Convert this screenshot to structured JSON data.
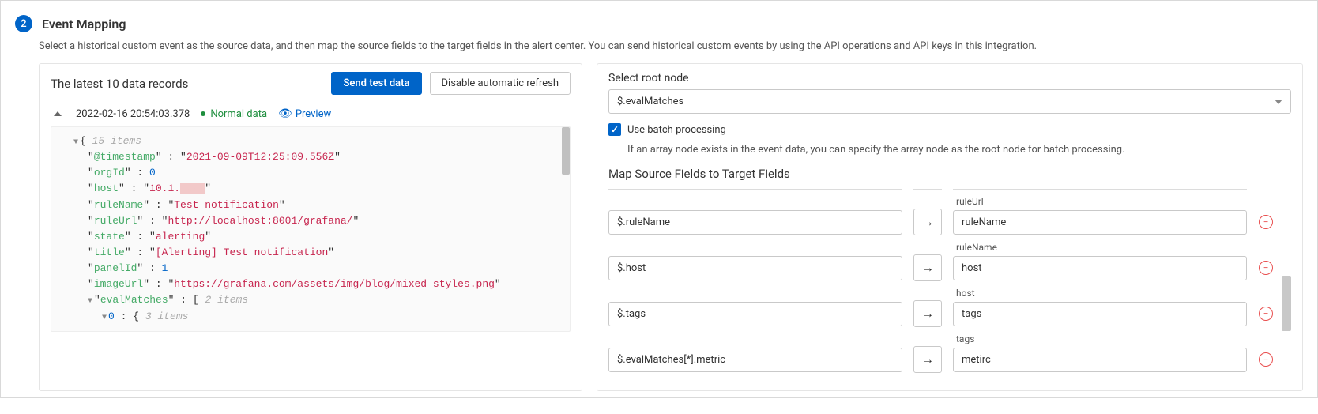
{
  "step": {
    "number": "2",
    "title": "Event Mapping"
  },
  "description": "Select a historical custom event as the source data, and then map the source fields to the target fields in the alert center. You can send historical custom events by using the API operations and API keys in this integration.",
  "left": {
    "title": "The latest 10 data records",
    "send_btn": "Send test data",
    "disable_btn": "Disable automatic refresh",
    "record_ts": "2022-02-16 20:54:03.378",
    "status": "Normal data",
    "preview": "Preview",
    "json": {
      "items_label": "15 items",
      "timestamp_k": "@timestamp",
      "timestamp_v": "2021-09-09T12:25:09.556Z",
      "orgId_k": "orgId",
      "orgId_v": "0",
      "host_k": "host",
      "host_v": "10.1.",
      "ruleName_k": "ruleName",
      "ruleName_v": "Test notification",
      "ruleUrl_k": "ruleUrl",
      "ruleUrl_v": "http://localhost:8001/grafana/",
      "state_k": "state",
      "state_v": "alerting",
      "title_k": "title",
      "title_v": "[Alerting] Test notification",
      "panelId_k": "panelId",
      "panelId_v": "1",
      "imageUrl_k": "imageUrl",
      "imageUrl_v": "https://grafana.com/assets/img/blog/mixed_styles.png",
      "evalMatches_k": "evalMatches",
      "evalMatches_items": "2 items",
      "idx0": "0",
      "idx0_items": "3 items"
    }
  },
  "right": {
    "root_label": "Select root node",
    "root_value": "$.evalMatches",
    "batch_label": "Use batch processing",
    "batch_help": "If an array node exists in the event data, you can specify the array node as the root node for batch processing.",
    "map_title": "Map Source Fields to Target Fields",
    "rows": [
      {
        "hint": "ruleUrl",
        "source": "$.ruleName",
        "target": "ruleName"
      },
      {
        "hint": "ruleName",
        "source": "$.host",
        "target": "host"
      },
      {
        "hint": "host",
        "source": "$.tags",
        "target": "tags"
      },
      {
        "hint": "tags",
        "source": "$.evalMatches[*].metric",
        "target": "metirc"
      }
    ]
  }
}
